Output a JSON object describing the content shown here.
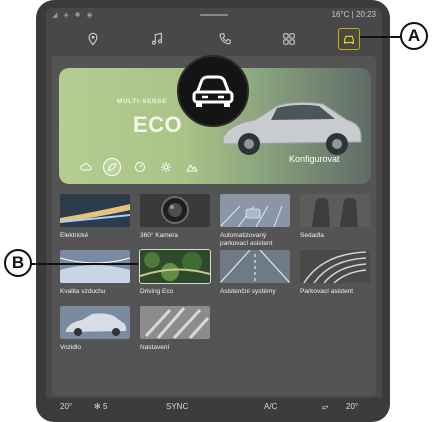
{
  "status": {
    "temperature": "16°C",
    "time": "20:23",
    "icons": [
      "signal-icon",
      "wifi-icon",
      "bluetooth-icon",
      "location-icon"
    ]
  },
  "nav": {
    "items": [
      {
        "name": "navigation",
        "icon": "location-pin-icon"
      },
      {
        "name": "music",
        "icon": "music-note-icon"
      },
      {
        "name": "phone",
        "icon": "phone-icon"
      },
      {
        "name": "apps",
        "icon": "apps-grid-icon"
      },
      {
        "name": "vehicle",
        "icon": "car-icon",
        "selected": true
      }
    ]
  },
  "banner": {
    "subtitle": "MULTI-SENSE",
    "title": "ECO",
    "configure_label": "Konfigurovat",
    "modes": [
      "cloud-icon",
      "eco-icon",
      "gauge-icon",
      "gear-icon",
      "mountain-icon"
    ],
    "active_mode_index": 1
  },
  "tiles": [
    {
      "label": "Elektrické"
    },
    {
      "label": "360° Kamera"
    },
    {
      "label": "Automatizovaný parkovací asistent"
    },
    {
      "label": "Sedadla"
    },
    {
      "label": "Kvalita vzduchu"
    },
    {
      "label": "Driving Eco",
      "highlighted": true
    },
    {
      "label": "Asistenční systémy"
    },
    {
      "label": "Parkovací asistent"
    },
    {
      "label": "Vozidlo"
    },
    {
      "label": "Nastavení"
    }
  ],
  "bottombar": {
    "temp_left": "20",
    "fan_speed": "5",
    "sync": "SYNC",
    "ac": "A/C",
    "temp_right": "20"
  },
  "callouts": {
    "a": "A",
    "b": "B"
  },
  "colors": {
    "accent_selected": "#c8b400",
    "banner_green": "#b4cd92"
  }
}
